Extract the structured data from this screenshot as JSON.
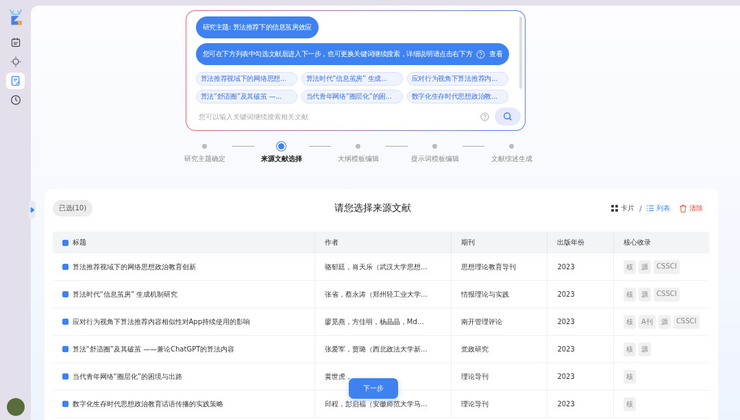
{
  "sidebar": {
    "items": [
      {
        "kind": "calendar",
        "selected": false
      },
      {
        "kind": "sun",
        "selected": false
      },
      {
        "kind": "edit",
        "selected": true
      },
      {
        "kind": "clock",
        "selected": false
      }
    ]
  },
  "chat": {
    "messages": [
      "研究主题: 算法推荐下的信息茧房效应",
      "您可在下方列表中勾选文献后进入下一步，也可更换关键词继续搜索，详细说明请点击右下方"
    ],
    "help_link": "查看",
    "chips": [
      "算法推荐视域下的网络思想...",
      "算法时代“信息茧房” 生成...",
      "应对行为视角下算法推荐内...",
      "算法“舒适圈”及其破茧 —...",
      "当代青年网络“圈层化”的困...",
      "数字化生存时代思想政治教..."
    ],
    "search": {
      "placeholder": "您可以输入关键词继续搜索相关文献"
    }
  },
  "steps": [
    {
      "label": "研究主题确定",
      "selected": false
    },
    {
      "label": "来源文献选择",
      "selected": true
    },
    {
      "label": "大纲模板编辑",
      "selected": false
    },
    {
      "label": "提示词模板编辑",
      "selected": false
    },
    {
      "label": "文献综述生成",
      "selected": false
    }
  ],
  "panel": {
    "selected_count": "已选(10)",
    "title": "请您选择来源文献",
    "view_card": "卡片",
    "separator": "/",
    "view_list": "列表",
    "list_selected": true,
    "clear": "清除",
    "table": {
      "columns": [
        "标题",
        "作者",
        "期刊",
        "出版年份",
        "核心收录"
      ],
      "header_checked": true,
      "rows": [
        {
          "checked": true,
          "title": "算法推荐视域下的网络思想政治教育创新",
          "author": "骆郁廷，肖天乐（武汉大学思想…",
          "journal": "思想理论教育导刊",
          "year": "2023",
          "tags": [
            "核",
            "源",
            "CSSCI"
          ]
        },
        {
          "checked": true,
          "title": "算法时代“信息茧房” 生成机制研究",
          "author": "张省，蔡永涛（郑州轻工业大学…",
          "journal": "情报理论与实践",
          "year": "2023",
          "tags": [
            "核",
            "源",
            "CSSCI"
          ]
        },
        {
          "checked": true,
          "title": "应对行为视角下算法推荐内容相似性对App持续使用的影响",
          "author": "廖觅燕，方佳明，杨晶晶，Md…",
          "journal": "南开管理评论",
          "year": "2023",
          "tags": [
            "核",
            "A刊",
            "源",
            "CSSCI"
          ]
        },
        {
          "checked": true,
          "title": "算法“舒适圈”及其破茧 ——兼论ChatGPT的算法内容",
          "author": "张爱军，贾璐（西北政法大学新…",
          "journal": "党政研究",
          "year": "2023",
          "tags": [
            "核",
            "源"
          ]
        },
        {
          "checked": true,
          "title": "当代青年网络“圈层化”的困境与出路",
          "author": "黄世虎，",
          "journal": "理论导刊",
          "year": "2023",
          "tags": [
            "核"
          ]
        },
        {
          "checked": true,
          "title": "数字化生存时代思想政治教育话语传播的实践策略",
          "author": "邱程，彭启福（安徽师范大学马…",
          "journal": "理论导刊",
          "year": "2023",
          "tags": [
            "核"
          ]
        }
      ]
    }
  },
  "next_button": "下一步"
}
